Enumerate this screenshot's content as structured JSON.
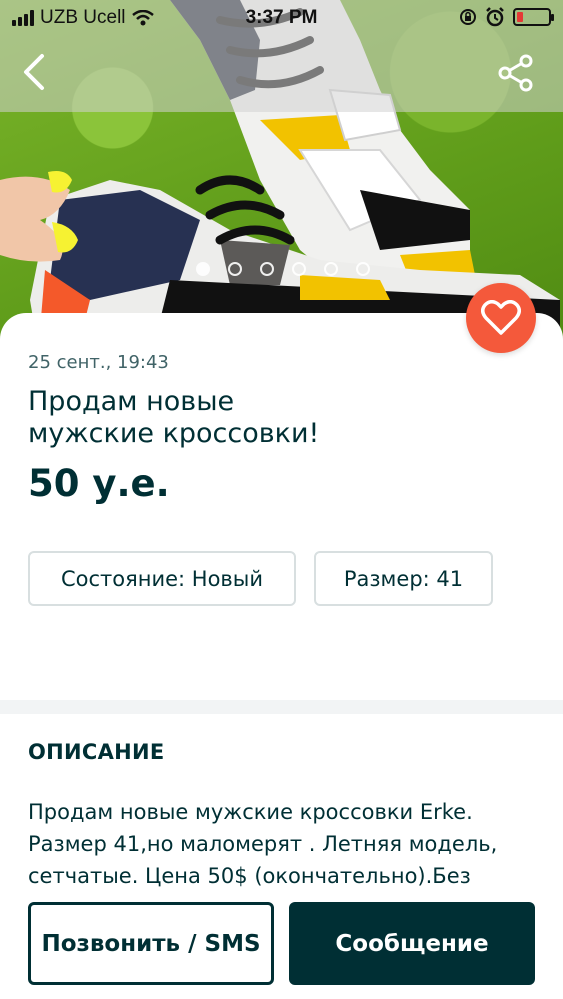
{
  "status_bar": {
    "carrier": "UZB Ucell",
    "time": "3:37 PM"
  },
  "icons": {
    "back": "chevron-left-icon",
    "share": "share-icon",
    "favorite": "heart-icon"
  },
  "gallery": {
    "total_images": 6,
    "current_index": 1
  },
  "listing": {
    "date": "25 сент., 19:43",
    "title_line1": "Продам новые",
    "title_line2": "мужские кроссовки!",
    "price": "50 у.е.",
    "chips": {
      "condition": "Состояние: Новый",
      "size": "Размер: 41"
    }
  },
  "description": {
    "heading": "ОПИСАНИЕ",
    "line1": "Продам новые мужские кроссовки Erke.",
    "line2": "Размер 41,но маломерят . Летняя модель,",
    "line3": "сетчатые. Цена 50$ (окончательно).Без"
  },
  "actions": {
    "call_label": "Позвонить / SMS",
    "message_label": "Сообщение"
  },
  "colors": {
    "primary": "#002f34",
    "accent": "#f4593b",
    "muted_text": "#406367",
    "chip_border": "#d8dfe0"
  }
}
